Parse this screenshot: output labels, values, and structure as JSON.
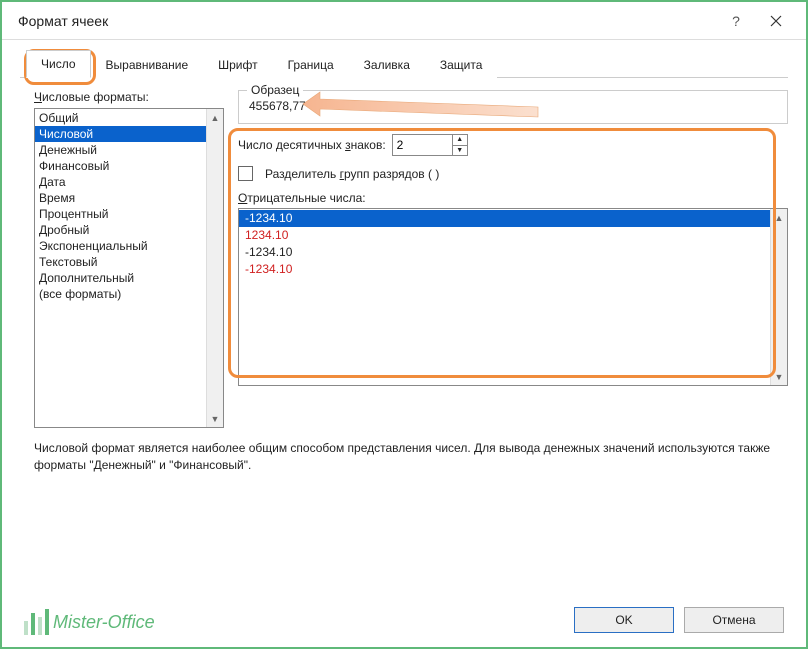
{
  "window": {
    "title": "Формат ячеек"
  },
  "tabs": {
    "items": [
      "Число",
      "Выравнивание",
      "Шрифт",
      "Граница",
      "Заливка",
      "Защита"
    ],
    "active_index": 0
  },
  "left": {
    "label_pre": "Ч",
    "label_rest": "исловые форматы:",
    "items": [
      "Общий",
      "Числовой",
      "Денежный",
      "Финансовый",
      "Дата",
      "Время",
      "Процентный",
      "Дробный",
      "Экспоненциальный",
      "Текстовый",
      "Дополнительный",
      "(все форматы)"
    ],
    "selected_index": 1
  },
  "sample": {
    "title": "Образец",
    "value": "455678,77"
  },
  "decimals": {
    "label_html": "Число десятичных знаков:",
    "underline_letter": "з",
    "value": "2"
  },
  "thousands": {
    "label": "Разделитель групп разрядов ( )",
    "underline_letter": "г",
    "checked": false
  },
  "negative": {
    "label": "Отрицательные числа:",
    "underline_letter": "О",
    "items": [
      {
        "text": "-1234.10",
        "red": false,
        "selected": true
      },
      {
        "text": "1234.10",
        "red": true,
        "selected": false
      },
      {
        "text": "-1234.10",
        "red": false,
        "selected": false
      },
      {
        "text": "-1234.10",
        "red": true,
        "selected": false
      }
    ]
  },
  "description": "Числовой формат является наиболее общим способом представления чисел. Для вывода денежных значений используются также форматы \"Денежный\" и \"Финансовый\".",
  "buttons": {
    "ok": "OK",
    "cancel": "Отмена"
  },
  "watermark": "Mister-Office"
}
